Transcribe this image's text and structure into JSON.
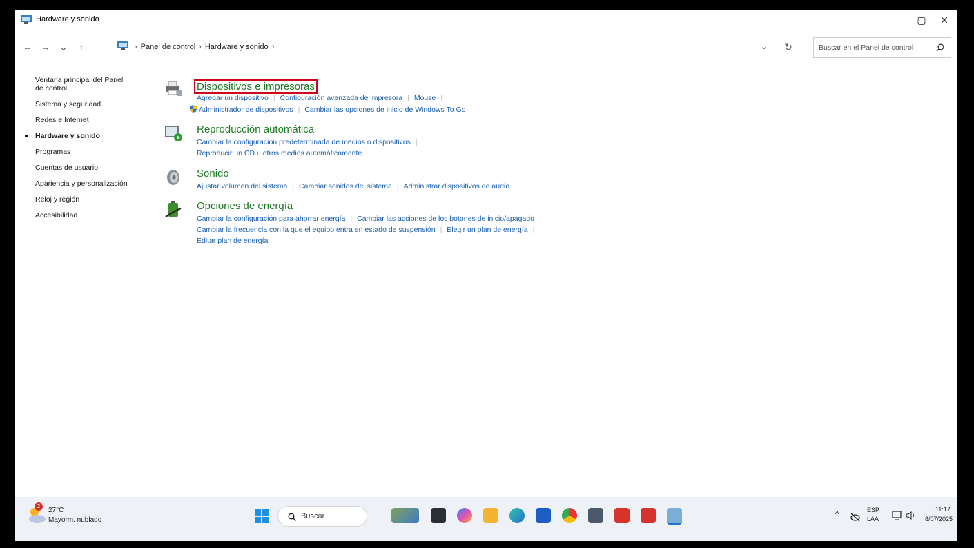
{
  "window": {
    "title": "Hardware y sonido",
    "controls": {
      "minimize": "—",
      "maximize": "▢",
      "close": "✕"
    }
  },
  "address": {
    "back": "←",
    "forward": "→",
    "recent": "⌄",
    "up": "↑",
    "breadcrumbs": [
      "Panel de control",
      "Hardware y sonido"
    ],
    "sep": "›",
    "dropdown": "⌄",
    "refresh": "↻",
    "search_placeholder": "Buscar en el Panel de control"
  },
  "sidebar": {
    "items": [
      {
        "label": "Ventana principal del Panel de control"
      },
      {
        "label": "Sistema y seguridad"
      },
      {
        "label": "Redes e Internet"
      },
      {
        "label": "Hardware y sonido",
        "active": true
      },
      {
        "label": "Programas"
      },
      {
        "label": "Cuentas de usuario"
      },
      {
        "label": "Apariencia y personalización"
      },
      {
        "label": "Reloj y región"
      },
      {
        "label": "Accesibilidad"
      }
    ]
  },
  "categories": [
    {
      "title": "Dispositivos e impresoras",
      "rows": [
        [
          "Agregar un dispositivo",
          "Configuración avanzada de impresora",
          "Mouse"
        ],
        [
          "Administrador de dispositivos",
          "Cambiar las opciones de inicio de Windows To Go"
        ]
      ]
    },
    {
      "title": "Reproducción automática",
      "rows": [
        [
          "Cambiar la configuración predeterminada de medios o dispositivos"
        ],
        [
          "Reproducir un CD u otros medios automáticamente"
        ]
      ]
    },
    {
      "title": "Sonido",
      "rows": [
        [
          "Ajustar volumen del sistema",
          "Cambiar sonidos del sistema",
          "Administrar dispositivos de audio"
        ]
      ]
    },
    {
      "title": "Opciones de energía",
      "rows": [
        [
          "Cambiar la configuración para ahorrar energía",
          "Cambiar las acciones de los botones de inicio/apagado"
        ],
        [
          "Cambiar la frecuencia con la que el equipo entra en estado de suspensión",
          "Elegir un plan de energía"
        ],
        [
          "Editar plan de energía"
        ]
      ]
    }
  ],
  "taskbar": {
    "weather": {
      "temp": "27°C",
      "desc": "Mayorm. nublado",
      "badge": "2"
    },
    "search_label": "Buscar",
    "tray": {
      "chevron": "^",
      "lang1": "ESP",
      "lang2": "LAA",
      "time": "11:17",
      "date": "8/07/2025"
    }
  },
  "colors": {
    "link": "#1b5fb0",
    "category": "#1e7a23",
    "highlight": "#d0021b"
  }
}
